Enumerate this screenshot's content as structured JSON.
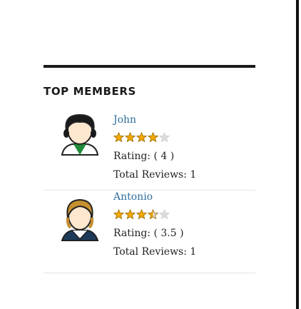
{
  "widget": {
    "title": "TOP MEMBERS"
  },
  "members": [
    {
      "name": "John",
      "rating_value": 4,
      "rating_max": 5,
      "rating_text": "Rating: ( 4 )",
      "reviews_text": "Total Reviews: 1",
      "avatar_icon": "male-avatar-dark-hair-icon"
    },
    {
      "name": "Antonio",
      "rating_value": 3.5,
      "rating_max": 5,
      "rating_text": "Rating: ( 3.5 )",
      "reviews_text": "Total Reviews: 1",
      "avatar_icon": "male-avatar-light-hair-icon"
    }
  ],
  "colors": {
    "link": "#2f6f9e",
    "star_fill": "#f2a900",
    "star_empty": "#dddddd"
  }
}
